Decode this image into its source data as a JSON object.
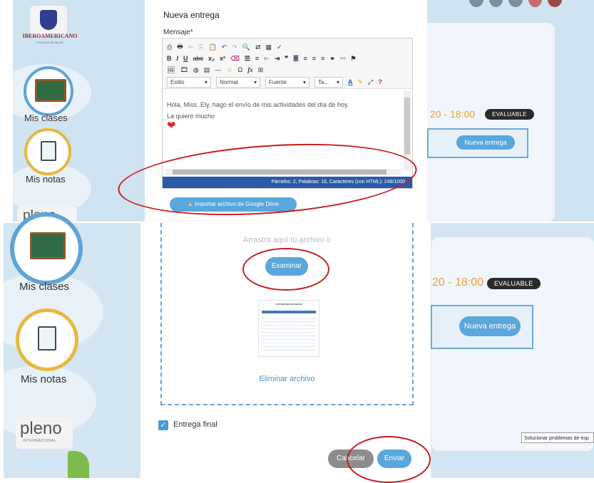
{
  "school": {
    "logo_text": "IBEROAMERICANO",
    "logo_sub": "COLEGIO BILINGÜE"
  },
  "sidebar": {
    "classes_label": "Mis clases",
    "grades_label": "Mis notas",
    "brand": "pleno",
    "brand_sub": "INTERNACIONAL"
  },
  "course_card": {
    "time": "20 - 18:00",
    "badge": "EVALUABLE",
    "new_delivery_button": "Nueva entrega"
  },
  "modal": {
    "title": "Nueva entrega",
    "message_label": "Mensaje*",
    "toolbar": {
      "style_select": "Estilo",
      "format_select": "Normal",
      "font_select": "Fuente",
      "size_select": "Ta..."
    },
    "editor_text": {
      "line1": "Hola, Miss. Ely, hago el envío de mis actividades del día de hoy.",
      "line2": "La quiero mucho"
    },
    "status_bar": "Párrafos: 2, Palabras: 16, Caracteres (con HTML): 248/1000",
    "drive_button": "Importar archivo de Google Drive",
    "dropzone_text": "Arrastra aquí tu archivo o",
    "browse_button": "Examinar",
    "attachment_title": "ACTIVIDADES DE INGLÉS",
    "remove_file": "Eliminar archivo",
    "final_delivery_label": "Entrega final",
    "final_delivery_checked": true,
    "cancel_button": "Cancelar",
    "send_button": "Enviar"
  },
  "tooltip": "Solucionar problemas de esp",
  "colors": {
    "accent": "#5aa7dc",
    "status_bar": "#2a5aa8",
    "annotation": "#c81e1e",
    "heart": "#e0202a"
  }
}
